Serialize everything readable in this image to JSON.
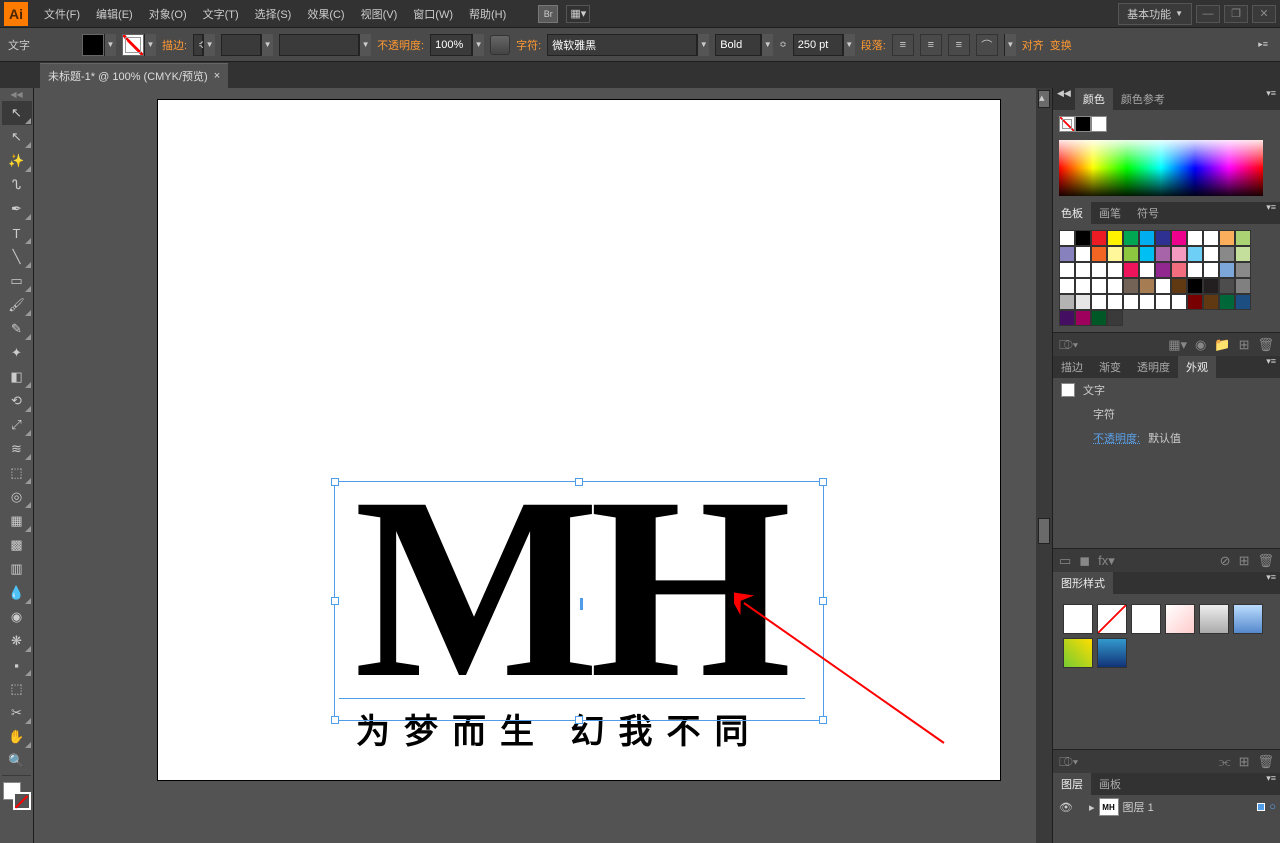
{
  "menubar": {
    "items": [
      "文件(F)",
      "编辑(E)",
      "对象(O)",
      "文字(T)",
      "选择(S)",
      "效果(C)",
      "视图(V)",
      "窗口(W)",
      "帮助(H)"
    ],
    "bridge": "Br",
    "workspace": "基本功能"
  },
  "controlbar": {
    "tool_label": "文字",
    "stroke_label": "描边:",
    "opacity_label": "不透明度:",
    "opacity_value": "100%",
    "char_label": "字符:",
    "font_family": "微软雅黑",
    "font_weight": "Bold",
    "font_size": "250 pt",
    "paragraph_label": "段落:",
    "align_label": "对齐",
    "transform_label": "变换"
  },
  "doc_tab": "未标题-1* @ 100% (CMYK/预览)",
  "canvas": {
    "big_text": "MH",
    "sub_text": "为梦而生 幻我不同"
  },
  "panels": {
    "color_tabs": [
      "颜色",
      "颜色参考"
    ],
    "swatch_tabs": [
      "色板",
      "画笔",
      "符号"
    ],
    "appearance_tabs": [
      "描边",
      "渐变",
      "透明度",
      "外观"
    ],
    "appearance": {
      "type": "文字",
      "char": "字符",
      "opacity_label": "不透明度:",
      "opacity_value": "默认值"
    },
    "gstyle_tab": "图形样式",
    "layer_tabs": [
      "图层",
      "画板"
    ],
    "layer_name": "图层 1",
    "layer_thumb": "MH",
    "layer_count": "1"
  },
  "swatch_colors": [
    "#ffffff",
    "#000000",
    "#ed1c24",
    "#fff200",
    "#00a651",
    "#00aeef",
    "#2e3192",
    "#ec008c",
    "#ffffff",
    "#ffffff",
    "#fbaf5d",
    "#acd373",
    "#8781bd",
    "#ffffff",
    "#f26522",
    "#fff799",
    "#8dc63f",
    "#00bff3",
    "#a864a8",
    "#f49ac1",
    "#6dcff6",
    "#ffffff",
    "#898989",
    "#c4df9b",
    "#ffffff",
    "#ffffff",
    "#ffffff",
    "#ffffff",
    "#ed145b",
    "#ffffff",
    "#92278f",
    "#f26d7d",
    "#ffffff",
    "#ffffff",
    "#7da7d9",
    "#898989",
    "#ffffff",
    "#ffffff",
    "#ffffff",
    "#ffffff",
    "#736357",
    "#a67c52",
    "#ffffff",
    "#603913",
    "#000000",
    "#231f20",
    "#4d4d4d",
    "#808080",
    "#b3b3b3",
    "#e6e6e6",
    "#ffffff",
    "#ffffff",
    "#ffffff",
    "#ffffff",
    "#ffffff",
    "#ffffff",
    "#790000",
    "#603913",
    "#006838",
    "#1c4e81",
    "#440e62",
    "#9e005d",
    "#005826",
    "#3a3a3a"
  ]
}
